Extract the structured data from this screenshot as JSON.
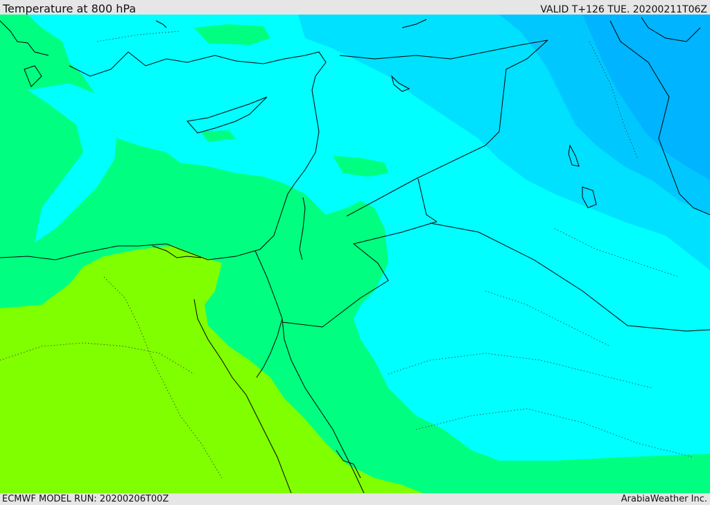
{
  "header": {
    "title": "Temperature at 800 hPa",
    "valid": "VALID T+126 TUE. 20200211T06Z"
  },
  "footer": {
    "model_run": "ECMWF MODEL RUN: 20200206T00Z",
    "credit": "ArabiaWeather Inc."
  },
  "map": {
    "field": "temperature",
    "level": "800 hPa",
    "colors": {
      "warmest": "#80ff00",
      "warm": "#00ff80",
      "mild": "#00ffff",
      "cool": "#00e0ff",
      "cold": "#00c8ff",
      "coldest": "#00b4ff",
      "coastline": "#000000",
      "borders": "#000000"
    }
  }
}
